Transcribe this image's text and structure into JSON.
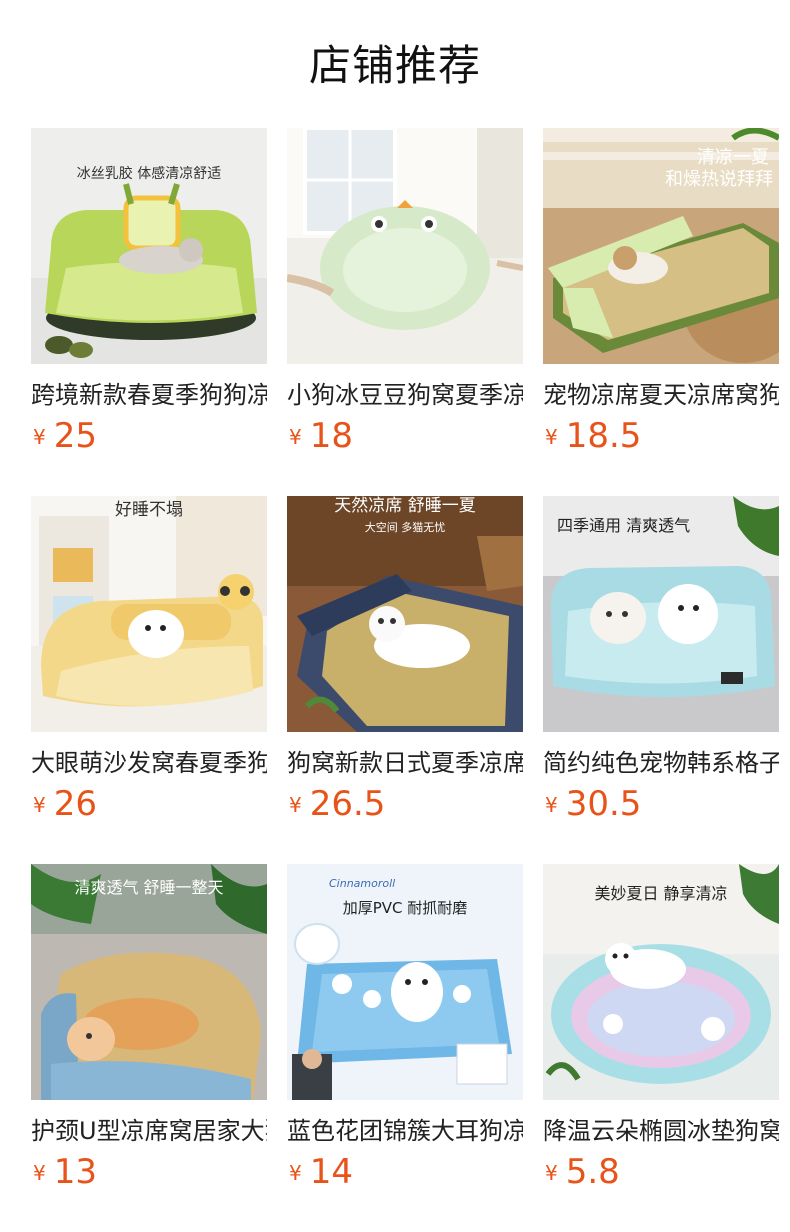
{
  "header": {
    "title": "店铺推荐"
  },
  "currency_symbol": "¥",
  "products": [
    {
      "name": "跨境新款春夏季狗狗凉席窝",
      "price": "25",
      "image_caption": "冰丝乳胶 体感清凉舒适",
      "image_caption_2": ""
    },
    {
      "name": "小狗冰豆豆狗窝夏季凉席垫",
      "price": "18",
      "image_caption": "",
      "image_caption_2": ""
    },
    {
      "name": "宠物凉席夏天凉席窝狗狗垫",
      "price": "18.5",
      "image_caption": "清凉一夏",
      "image_caption_2": "和燥热说拜拜"
    },
    {
      "name": "大眼萌沙发窝春夏季狗窝",
      "price": "26",
      "image_caption": "好睡不塌",
      "image_caption_2": ""
    },
    {
      "name": "狗窝新款日式夏季凉席窝",
      "price": "26.5",
      "image_caption": "天然凉席 舒睡一夏",
      "image_caption_2": "大空间 多猫无忧"
    },
    {
      "name": "简约纯色宠物韩系格子窝",
      "price": "30.5",
      "image_caption": "四季通用 清爽透气",
      "image_caption_2": ""
    },
    {
      "name": "护颈U型凉席窝居家大狗",
      "price": "13",
      "image_caption": "清爽透气 舒睡一整天",
      "image_caption_2": ""
    },
    {
      "name": "蓝色花团锦簇大耳狗凉垫",
      "price": "14",
      "image_caption": "加厚PVC 耐抓耐磨",
      "image_caption_2": "Cinnamoroll"
    },
    {
      "name": "降温云朵椭圆冰垫狗窝夏",
      "price": "5.8",
      "image_caption": "美妙夏日 静享清凉",
      "image_caption_2": ""
    }
  ]
}
